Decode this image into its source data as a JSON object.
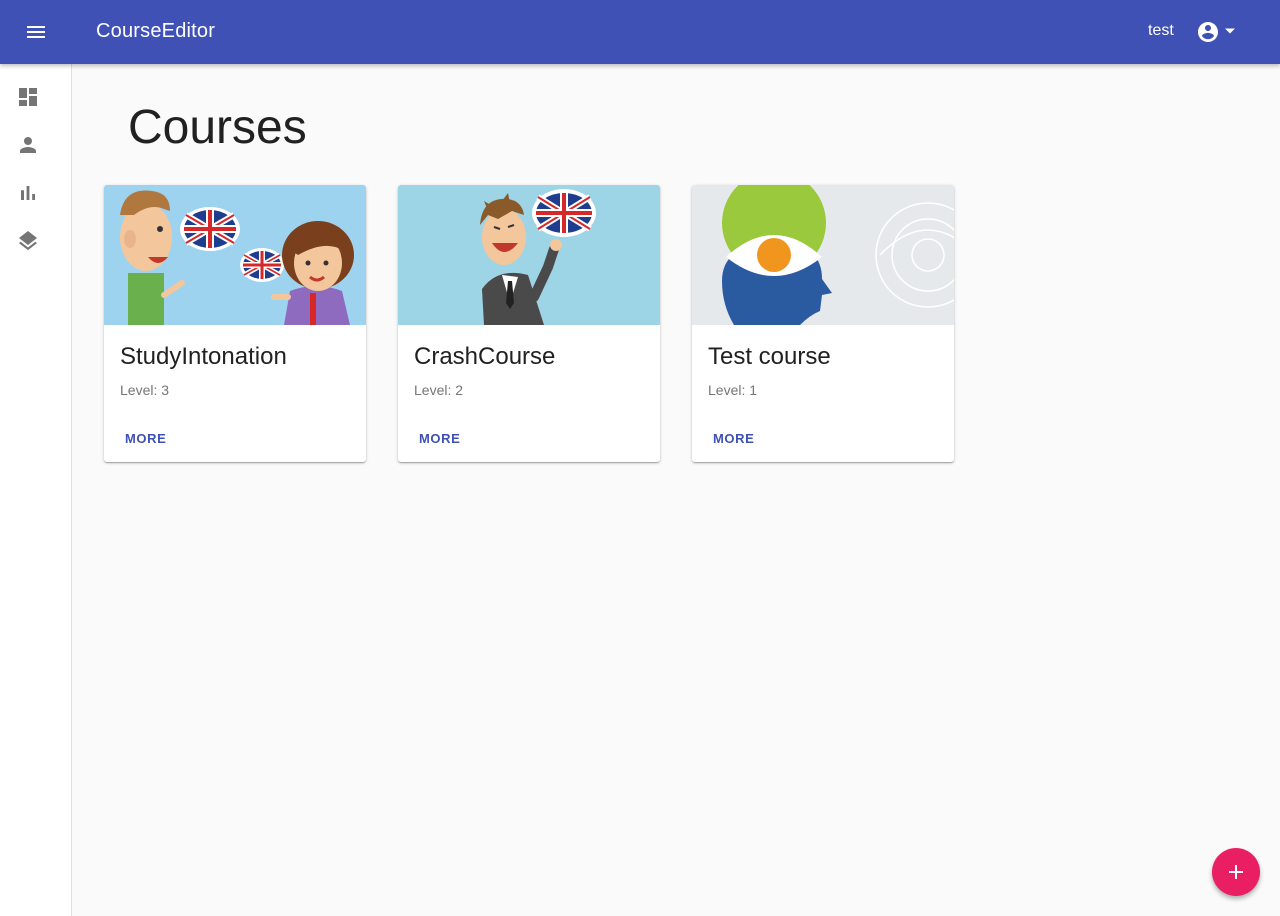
{
  "app": {
    "title": "CourseEditor"
  },
  "header": {
    "user_name": "test"
  },
  "sidebar": {
    "items": [
      {
        "icon": "dashboard-icon"
      },
      {
        "icon": "person-icon"
      },
      {
        "icon": "bar-chart-icon"
      },
      {
        "icon": "layers-icon"
      }
    ]
  },
  "page": {
    "title": "Courses"
  },
  "courses": [
    {
      "title": "StudyIntonation",
      "level": "Level: 3",
      "action": "MORE"
    },
    {
      "title": "CrashCourse",
      "level": "Level: 2",
      "action": "MORE"
    },
    {
      "title": "Test course",
      "level": "Level: 1",
      "action": "MORE"
    }
  ],
  "fab": {
    "icon": "add-icon"
  },
  "colors": {
    "primary": "#3f51b5",
    "accent": "#e91e63",
    "background": "#fafafa"
  }
}
